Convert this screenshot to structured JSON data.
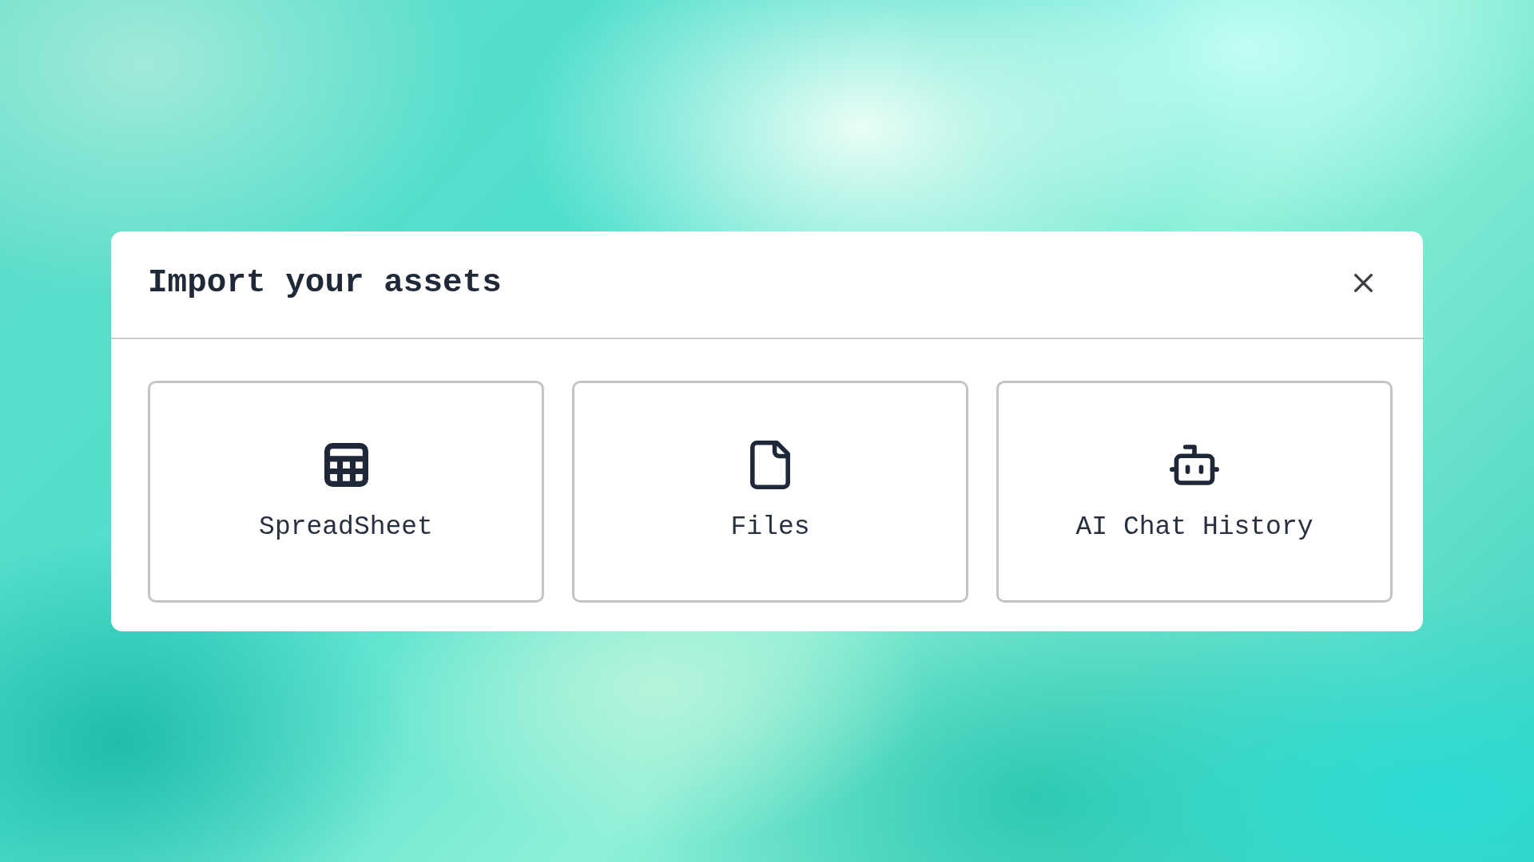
{
  "dialog": {
    "title": "Import your assets",
    "options": [
      {
        "kind": "spreadsheet",
        "label": "SpreadSheet"
      },
      {
        "kind": "files",
        "label": "Files"
      },
      {
        "kind": "chat_history",
        "label": "AI Chat History"
      }
    ]
  }
}
